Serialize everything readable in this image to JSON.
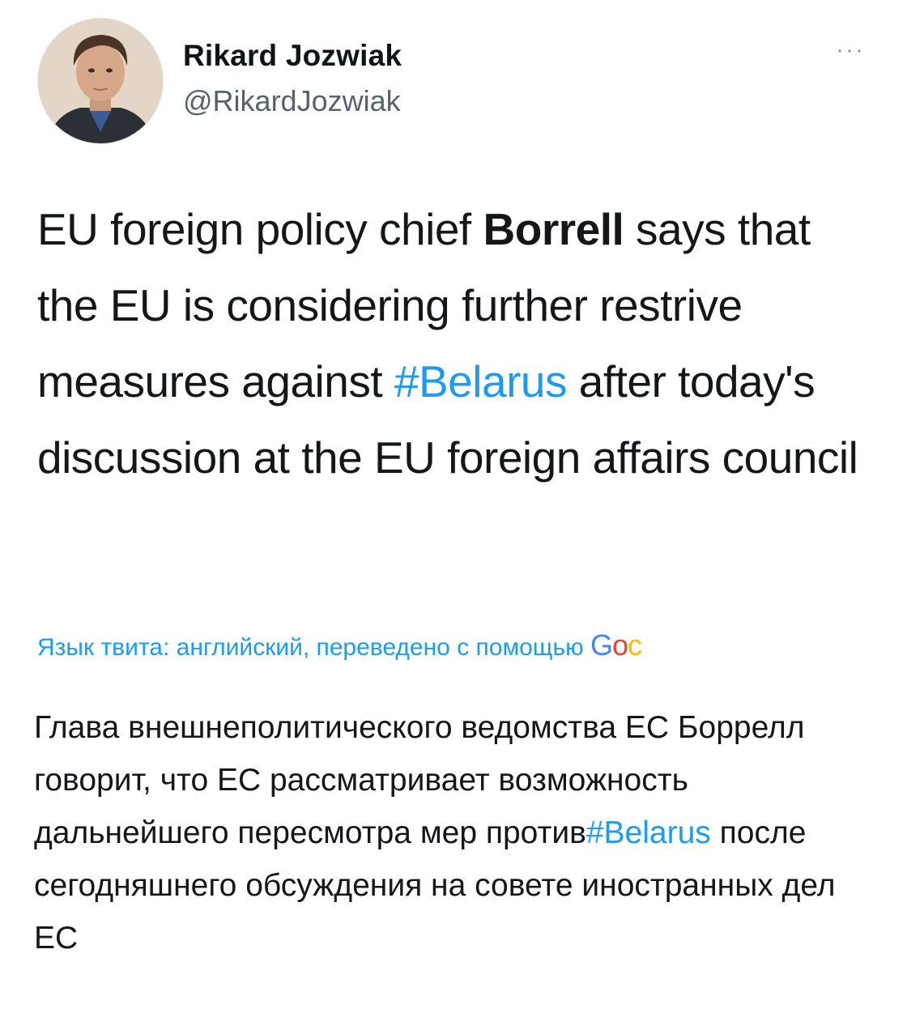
{
  "author": {
    "display_name": "Rikard Jozwiak",
    "handle": "@RikardJozwiak"
  },
  "menu": {
    "more_label": "···"
  },
  "tweet": {
    "part1": "EU foreign policy chief ",
    "bold": "Borrell",
    "part2": " says that the EU is considering further restrive measures against ",
    "hashtag": "#Belarus",
    "part3": " after today's discussion at the EU foreign affairs council"
  },
  "translation_bar": {
    "label": "Язык твита: английский, переведено с помощью ",
    "logo_g": "G",
    "logo_o1": "o",
    "logo_o2": "c"
  },
  "translation": {
    "part1": "Глава внешнеполитического ведомства ЕС Боррелл говорит, что ЕС рассматривает возможность дальнейшего пересмотра мер против",
    "hashtag": "#Belarus",
    "part2": " после сегодняшнего обсуждения на совете иностранных дел ЕС"
  },
  "colors": {
    "link": "#1d9bf0",
    "text": "#14171a",
    "secondary": "#536471"
  }
}
